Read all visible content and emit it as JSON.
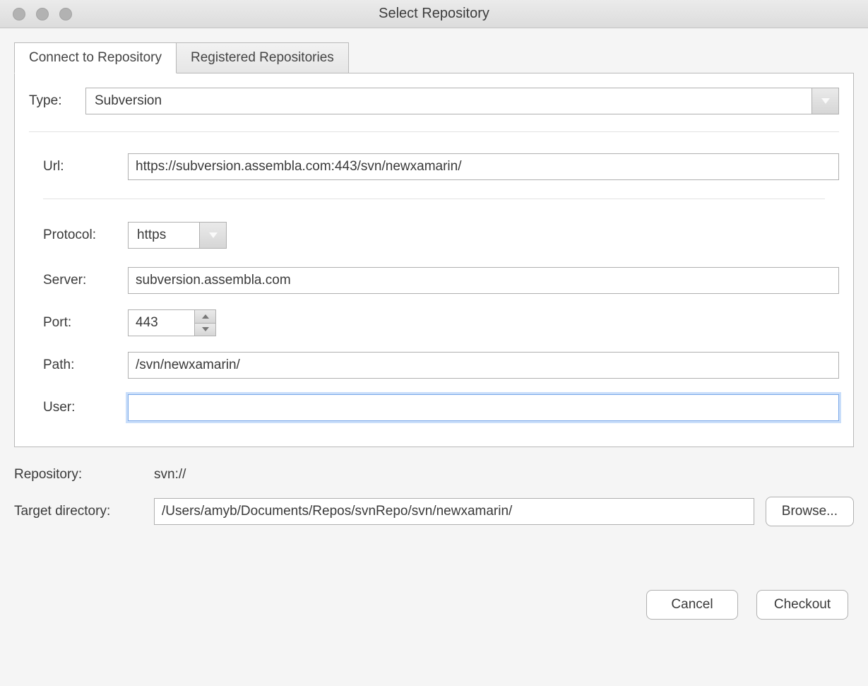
{
  "window": {
    "title": "Select Repository"
  },
  "tabs": {
    "connect": "Connect to Repository",
    "registered": "Registered Repositories"
  },
  "labels": {
    "type": "Type:",
    "url": "Url:",
    "protocol": "Protocol:",
    "server": "Server:",
    "port": "Port:",
    "path": "Path:",
    "user": "User:",
    "repository": "Repository:",
    "target_dir": "Target directory:"
  },
  "fields": {
    "type": "Subversion",
    "url": "https://subversion.assembla.com:443/svn/newxamarin/",
    "protocol": "https",
    "server": "subversion.assembla.com",
    "port": "443",
    "path": "/svn/newxamarin/",
    "user": "",
    "repository_value": "svn://",
    "target_dir": "/Users/amyb/Documents/Repos/svnRepo/svn/newxamarin/"
  },
  "buttons": {
    "browse": "Browse...",
    "cancel": "Cancel",
    "checkout": "Checkout"
  }
}
